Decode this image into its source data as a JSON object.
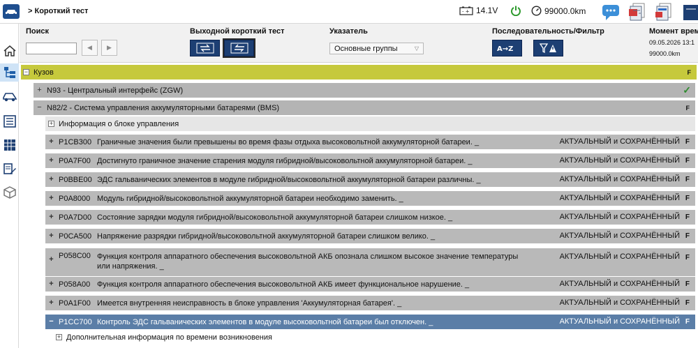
{
  "topbar": {
    "title": "> Короткий тест",
    "voltage": "14.1V",
    "odometer": "99000.0km",
    "icons": [
      "car-icon",
      "battery-icon",
      "power-icon",
      "odometer-icon",
      "chat-icon",
      "document-red-icon",
      "document-blue-icon",
      "document-dark-icon"
    ]
  },
  "sidebar": {
    "items": [
      "home-icon",
      "hierarchy-icon",
      "car-side-icon",
      "list-icon",
      "grid-icon",
      "edit-icon",
      "package-icon"
    ],
    "active_index": 1
  },
  "header": {
    "search_label": "Поиск",
    "search_value": "",
    "output_label": "Выходной короткий тест",
    "pointer_label": "Указатель",
    "pointer_value": "Основные группы",
    "sequence_label": "Последовательность/Фильтр",
    "moment_label": "Момент врем",
    "moment_date": "09.05.2026 13:1",
    "moment_odo": "99000.0km"
  },
  "tree": {
    "group": {
      "toggle": "−",
      "label": "Кузов",
      "flag": "F"
    },
    "n93": {
      "toggle": "+",
      "label": "N93 - Центральный интерфейс (ZGW)",
      "status": "✓"
    },
    "n82": {
      "toggle": "−",
      "label": "N82/2 - Система управления аккумуляторными батареями (BMS)",
      "flag": "F"
    },
    "info": {
      "toggle": "+",
      "label": "Информация о блоке управления"
    },
    "dtcs": [
      {
        "toggle": "+",
        "code": "P1CB300",
        "desc": "Граничные значения были превышены во время фазы отдыха высоковольтной аккумуляторной батареи. _",
        "state": "АКТУАЛЬНЫЙ и СОХРАНЁННЫЙ",
        "flag": "F"
      },
      {
        "toggle": "+",
        "code": "P0A7F00",
        "desc": "Достигнуто граничное значение старения модуля гибридной/высоковольтной аккумуляторной батареи. _",
        "state": "АКТУАЛЬНЫЙ и СОХРАНЁННЫЙ",
        "flag": "F"
      },
      {
        "toggle": "+",
        "code": "P0BBE00",
        "desc": "ЭДС гальванических элементов в модуле гибридной/высоковольтной аккумуляторной батареи различны. _",
        "state": "АКТУАЛЬНЫЙ и СОХРАНЁННЫЙ",
        "flag": "F"
      },
      {
        "toggle": "+",
        "code": "P0A8000",
        "desc": "Модуль гибридной/высоковольтной аккумуляторной батареи необходимо заменить. _",
        "state": "АКТУАЛЬНЫЙ и СОХРАНЁННЫЙ",
        "flag": "F"
      },
      {
        "toggle": "+",
        "code": "P0A7D00",
        "desc": "Состояние зарядки модуля гибридной/высоковольтной аккумуляторной батареи слишком низкое. _",
        "state": "АКТУАЛЬНЫЙ и СОХРАНЁННЫЙ",
        "flag": "F"
      },
      {
        "toggle": "+",
        "code": "P0CA500",
        "desc": "Напряжение разрядки гибридной/высоковольтной аккумуляторной батареи слишком велико. _",
        "state": "АКТУАЛЬНЫЙ и СОХРАНЁННЫЙ",
        "flag": "F"
      },
      {
        "toggle": "+",
        "code": "P058C00",
        "desc": "Функция контроля аппаратного обеспечения высоковольтной АКБ опознала слишком высокое значение температуры или напряжения. _",
        "state": "АКТУАЛЬНЫЙ и СОХРАНЁННЫЙ",
        "flag": "F"
      },
      {
        "toggle": "+",
        "code": "P058A00",
        "desc": "Функция контроля аппаратного обеспечения высоковольтной АКБ имеет функциональное нарушение. _",
        "state": "АКТУАЛЬНЫЙ и СОХРАНЁННЫЙ",
        "flag": "F"
      },
      {
        "toggle": "+",
        "code": "P0A1F00",
        "desc": "Имеется внутренняя неисправность в блоке управления 'Аккумуляторная батарея'. _",
        "state": "АКТУАЛЬНЫЙ и СОХРАНЁННЫЙ",
        "flag": "F"
      },
      {
        "toggle": "−",
        "code": "P1CC700",
        "desc": "Контроль ЭДС гальванических элементов в модуле высоковольтной батареи был отключен. _",
        "state": "АКТУАЛЬНЫЙ и СОХРАНЁННЫЙ",
        "flag": "F"
      }
    ],
    "addinfo": {
      "toggle": "+",
      "label": "Дополнительная информация по времени возникновения"
    }
  },
  "colors": {
    "group_bg": "#c6c93c",
    "row_bg": "#b9b9b9",
    "selected_bg": "#5b7ea7",
    "accent": "#1d3f73",
    "ok_green": "#2e8b2e"
  }
}
